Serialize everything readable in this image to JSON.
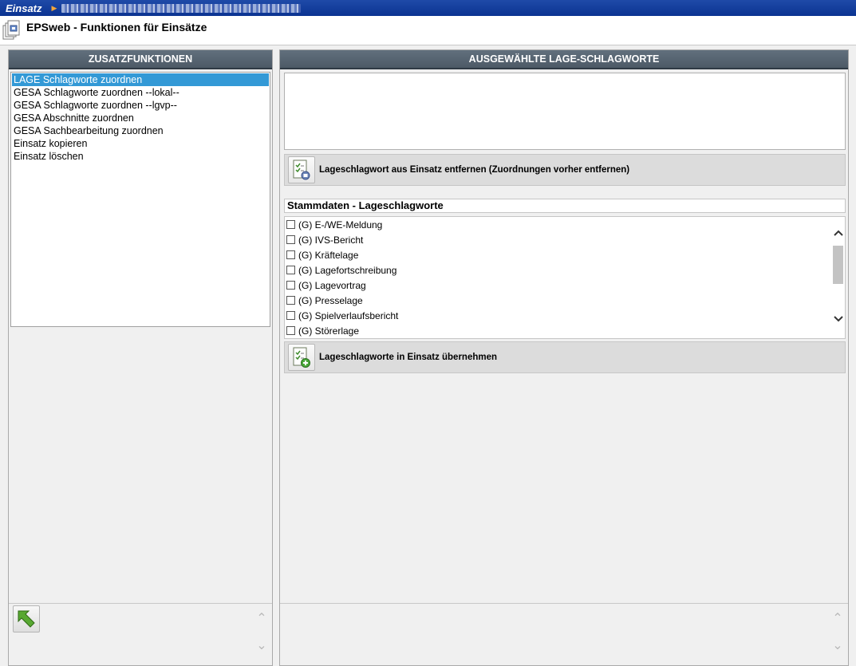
{
  "app": {
    "name": "Einsatz"
  },
  "title": "EPSweb - Funktionen für Einsätze",
  "left_panel": {
    "header": "ZUSATZFUNKTIONEN",
    "items": [
      {
        "label": "LAGE Schlagworte zuordnen",
        "selected": true
      },
      {
        "label": "GESA Schlagworte zuordnen --lokal--",
        "selected": false
      },
      {
        "label": "GESA Schlagworte zuordnen --lgvp--",
        "selected": false
      },
      {
        "label": "GESA Abschnitte zuordnen",
        "selected": false
      },
      {
        "label": "GESA Sachbearbeitung zuordnen",
        "selected": false
      },
      {
        "label": "Einsatz kopieren",
        "selected": false
      },
      {
        "label": "Einsatz löschen",
        "selected": false
      }
    ]
  },
  "right_panel": {
    "header": "AUSGEWÄHLTE LAGE-SCHLAGWORTE",
    "remove_label": "Lageschlagwort aus Einsatz entfernen (Zuordnungen vorher entfernen)",
    "stamm_title": "Stammdaten - Lageschlagworte",
    "options": [
      {
        "label": "(G) E-/WE-Meldung",
        "checked": false
      },
      {
        "label": "(G) IVS-Bericht",
        "checked": false
      },
      {
        "label": "(G) Kräftelage",
        "checked": false
      },
      {
        "label": "(G) Lagefortschreibung",
        "checked": false
      },
      {
        "label": "(G) Lagevortrag",
        "checked": false
      },
      {
        "label": "(G) Presselage",
        "checked": false
      },
      {
        "label": "(G) Spielverlaufsbericht",
        "checked": false
      },
      {
        "label": "(G) Störerlage",
        "checked": false
      }
    ],
    "add_label": "Lageschlagworte in Einsatz übernehmen"
  },
  "colors": {
    "topbar": "#0b3391",
    "panel_header": "#4d5a66",
    "selection": "#3399d6"
  }
}
